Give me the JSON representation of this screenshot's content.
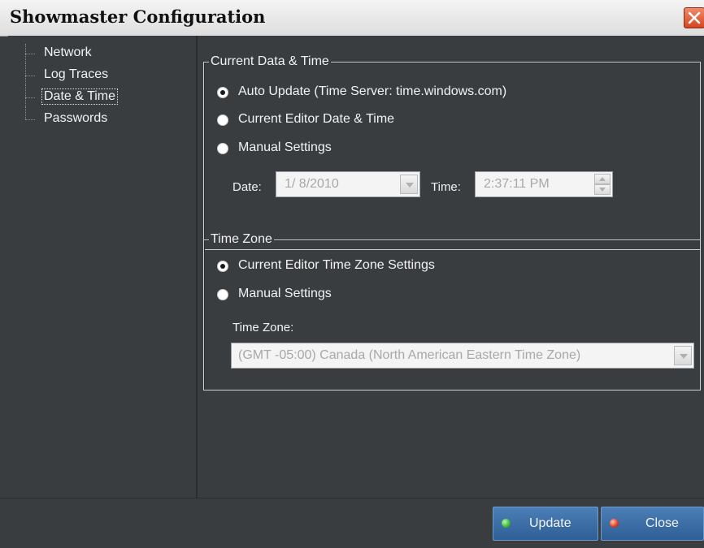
{
  "window": {
    "title": "Showmaster Configuration"
  },
  "tree": {
    "items": [
      {
        "label": "Network"
      },
      {
        "label": "Log Traces"
      },
      {
        "label": "Date & Time",
        "selected": true
      },
      {
        "label": "Passwords"
      }
    ]
  },
  "datetime_group": {
    "title": "Current Data & Time",
    "options": [
      {
        "label": "Auto Update (Time Server: time.windows.com)",
        "checked": true
      },
      {
        "label": "Current Editor Date & Time",
        "checked": false
      },
      {
        "label": "Manual Settings",
        "checked": false
      }
    ],
    "date_label": "Date:",
    "date_value": "1/ 8/2010",
    "time_label": "Time:",
    "time_value": "2:37:11 PM"
  },
  "timezone_group": {
    "title": "Time Zone",
    "options": [
      {
        "label": "Current Editor Time Zone Settings",
        "checked": true
      },
      {
        "label": "Manual Settings",
        "checked": false
      }
    ],
    "zone_label": "Time Zone:",
    "zone_value": "(GMT -05:00) Canada (North American Eastern Time Zone)"
  },
  "buttons": {
    "update_label": "Update",
    "close_label": "Close"
  },
  "colors": {
    "update_led": "#3fbf3a",
    "close_led": "#e0442a",
    "button_blue": "#3d6fa6",
    "panel_bg": "#3a3d40"
  }
}
